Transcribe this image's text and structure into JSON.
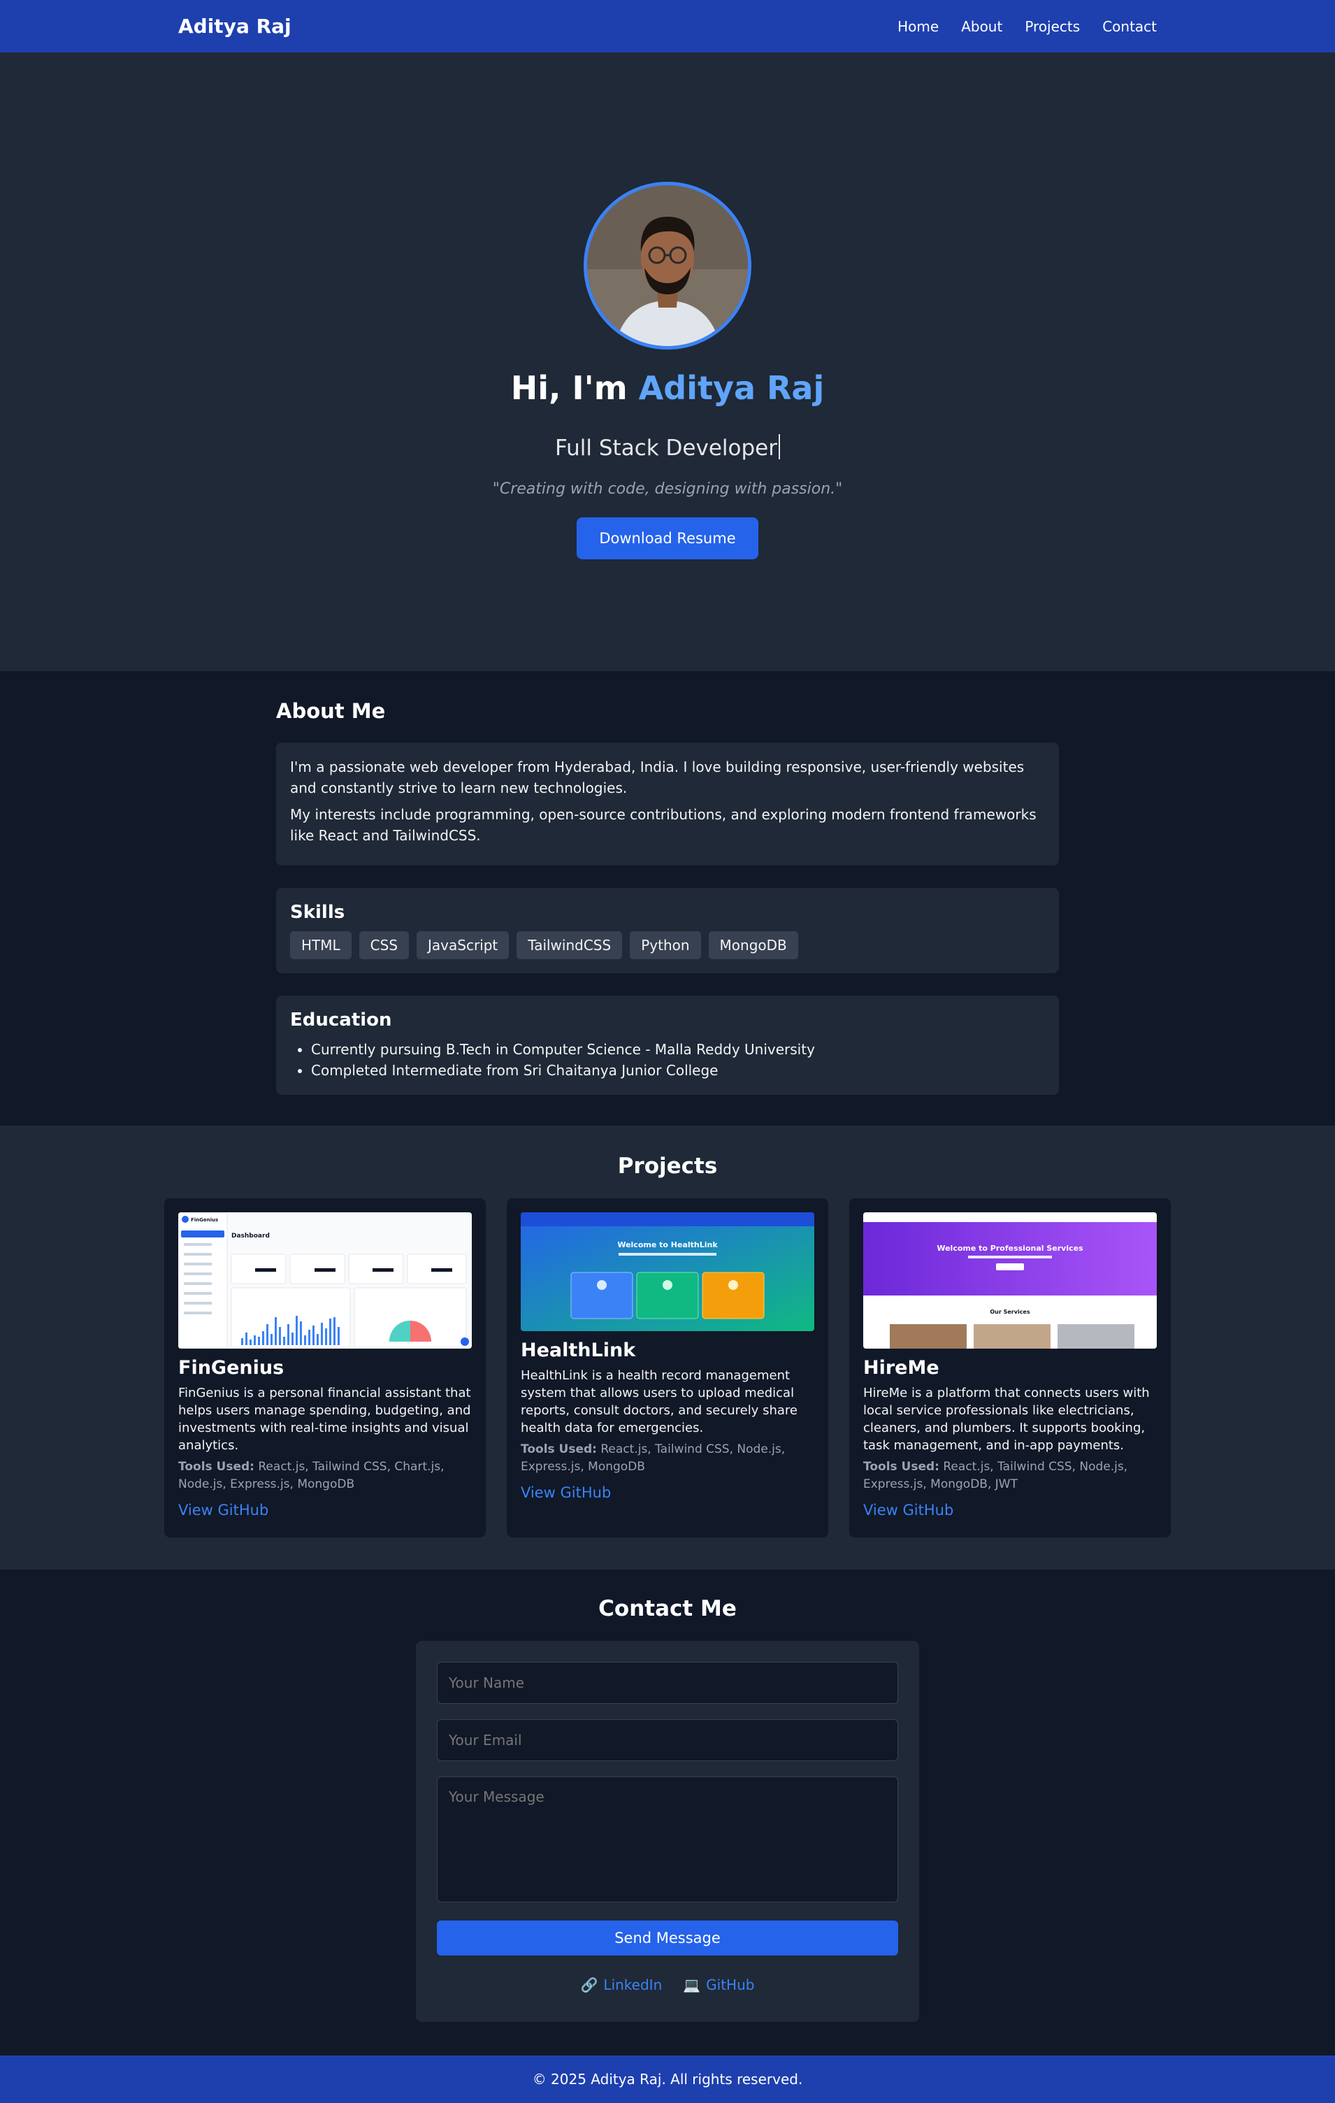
{
  "nav": {
    "brand": "Aditya Raj",
    "links": [
      "Home",
      "About",
      "Projects",
      "Contact"
    ]
  },
  "hero": {
    "greeting": "Hi, I'm ",
    "name": "Aditya Raj",
    "role": "Full Stack Developer",
    "quote": "\"Creating with code, designing with passion.\"",
    "cta": "Download Resume"
  },
  "about": {
    "heading": "About Me",
    "paragraphs": [
      "I'm a passionate web developer from Hyderabad, India. I love building responsive, user-friendly websites and constantly strive to learn new technologies.",
      "My interests include programming, open-source contributions, and exploring modern frontend frameworks like React and TailwindCSS."
    ]
  },
  "skills": {
    "heading": "Skills",
    "items": [
      "HTML",
      "CSS",
      "JavaScript",
      "TailwindCSS",
      "Python",
      "MongoDB"
    ]
  },
  "education": {
    "heading": "Education",
    "items": [
      "Currently pursuing B.Tech in Computer Science - Malla Reddy University",
      "Completed Intermediate from Sri Chaitanya Junior College"
    ]
  },
  "projects": {
    "heading": "Projects",
    "tools_label": "Tools Used:",
    "items": [
      {
        "title": "FinGenius",
        "desc": "FinGenius is a personal financial assistant that helps users manage spending, budgeting, and investments with real-time insights and visual analytics.",
        "tools": " React.js, Tailwind CSS, Chart.js, Node.js, Express.js, MongoDB",
        "link": "View GitHub"
      },
      {
        "title": "HealthLink",
        "desc": "HealthLink is a health record management system that allows users to upload medical reports, consult doctors, and securely share health data for emergencies.",
        "tools": " React.js, Tailwind CSS, Node.js, Express.js, MongoDB",
        "link": "View GitHub"
      },
      {
        "title": "HireMe",
        "desc": "HireMe is a platform that connects users with local service professionals like electricians, cleaners, and plumbers. It supports booking, task management, and in-app payments.",
        "tools": " React.js, Tailwind CSS, Node.js, Express.js, MongoDB, JWT",
        "link": "View GitHub"
      }
    ],
    "thumbs": {
      "fin_brand": "FinGenius",
      "fin_dash": "Dashboard",
      "health_welcome": "Welcome to HealthLink",
      "hire_welcome": "Welcome to Professional Services",
      "hire_services": "Our Services"
    }
  },
  "contact": {
    "heading": "Contact Me",
    "name_placeholder": "Your Name",
    "email_placeholder": "Your Email",
    "message_placeholder": "Your Message",
    "send": "Send Message",
    "linkedin": "LinkedIn",
    "github": "GitHub",
    "linkedin_icon": "🔗",
    "github_icon": "💻"
  },
  "footer": {
    "text": "© 2025 Aditya Raj. All rights reserved."
  },
  "colors": {
    "nav": "#1e40af",
    "accent": "#60a5fa",
    "button": "#2563eb",
    "dark": "#111827",
    "panel": "#1f2937"
  }
}
